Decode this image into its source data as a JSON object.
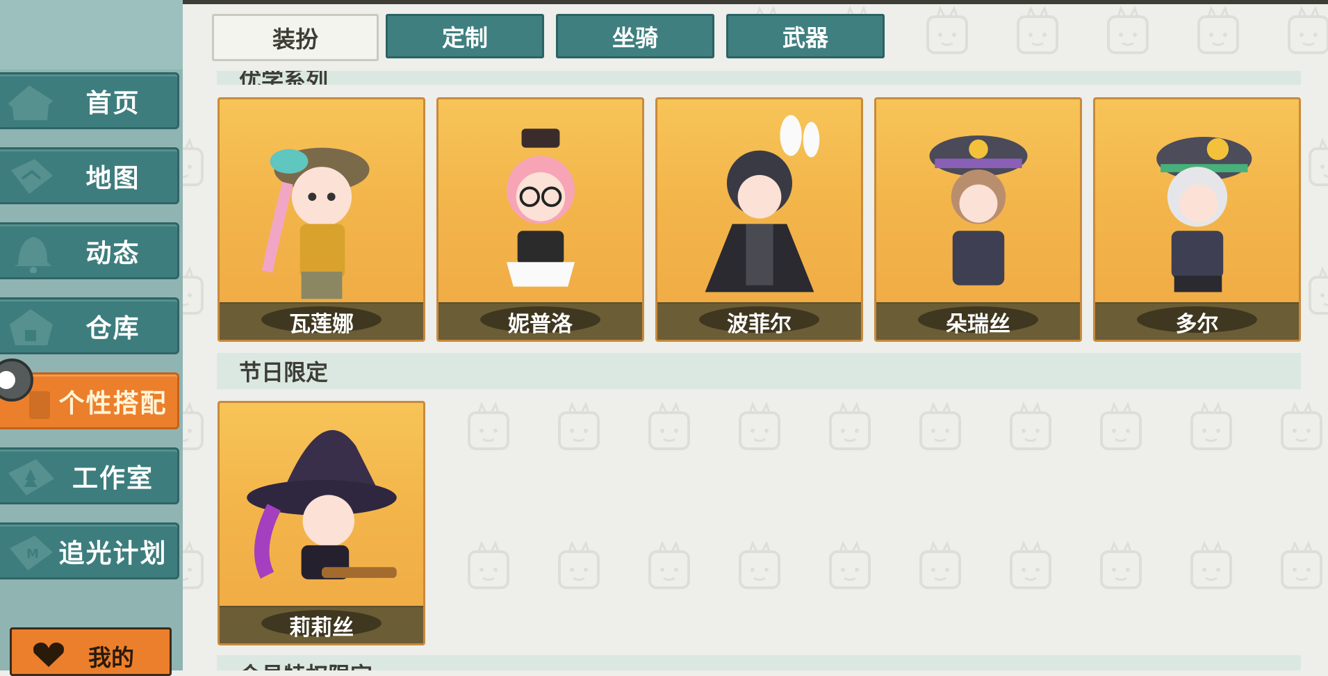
{
  "sidebar": {
    "items": [
      {
        "label": "首页",
        "icon": "house-icon"
      },
      {
        "label": "地图",
        "icon": "map-icon"
      },
      {
        "label": "动态",
        "icon": "bell-icon"
      },
      {
        "label": "仓库",
        "icon": "box-icon"
      },
      {
        "label": "个性搭配",
        "icon": "hanger-icon",
        "active": true
      },
      {
        "label": "工作室",
        "icon": "tree-icon"
      },
      {
        "label": "追光计划",
        "icon": "medal-icon"
      }
    ],
    "my_label": "我的"
  },
  "tabs": [
    {
      "label": "装扮",
      "active": true
    },
    {
      "label": "定制"
    },
    {
      "label": "坐骑"
    },
    {
      "label": "武器"
    }
  ],
  "sections": [
    {
      "title": "优学系列",
      "cut": "top"
    },
    {
      "title": "节日限定"
    },
    {
      "title": "会员特权限定",
      "cut": "bottom"
    }
  ],
  "characters": [
    {
      "name": "瓦莲娜",
      "section": "优学系列"
    },
    {
      "name": "妮普洛",
      "section": "优学系列"
    },
    {
      "name": "波菲尔",
      "section": "优学系列"
    },
    {
      "name": "朵瑞丝",
      "section": "优学系列"
    },
    {
      "name": "多尔",
      "section": "优学系列"
    },
    {
      "name": "莉莉丝",
      "section": "节日限定"
    }
  ],
  "colors": {
    "nav_teal": "#3e7d7e",
    "active_orange": "#ec7f2c",
    "card_gold": "#f3b64b",
    "caption_brown": "#6b5d35"
  }
}
